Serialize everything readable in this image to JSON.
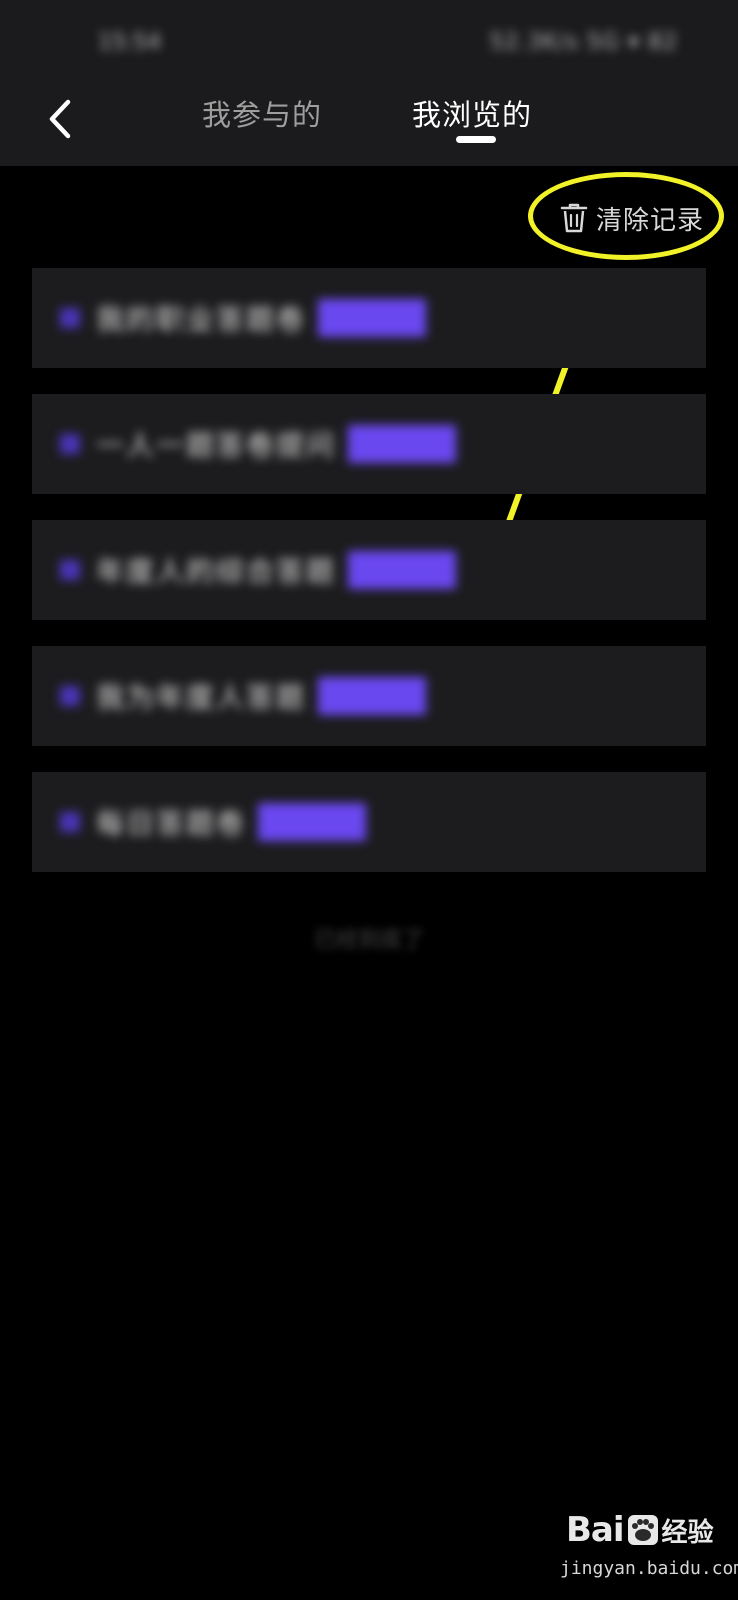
{
  "status_bar": {
    "time": "15:54",
    "icons_text": "52.3K/s 5G ▾ 82"
  },
  "header": {
    "tabs": [
      {
        "label": "我参与的",
        "active": false
      },
      {
        "label": "我浏览的",
        "active": true
      }
    ]
  },
  "toolbar": {
    "clear_label": "清除记录"
  },
  "list": {
    "items": [
      {
        "title": "我的职业答题卷",
        "tag": ""
      },
      {
        "title": "一人一题答卷提问",
        "tag": ""
      },
      {
        "title": "年度人的综合答题",
        "tag": ""
      },
      {
        "title": "我为年度人答题",
        "tag": ""
      },
      {
        "title": "每日答题卷",
        "tag": ""
      }
    ],
    "end_text": "已经到底了"
  },
  "colors": {
    "accent": "#6a48f0",
    "highlight": "#f2f229",
    "item_bg": "#1c1c1e",
    "header_bg": "#1b1b1d"
  },
  "watermark": {
    "brand": "Bai",
    "brand_suffix": "经验",
    "url": "jingyan.baidu.com"
  }
}
